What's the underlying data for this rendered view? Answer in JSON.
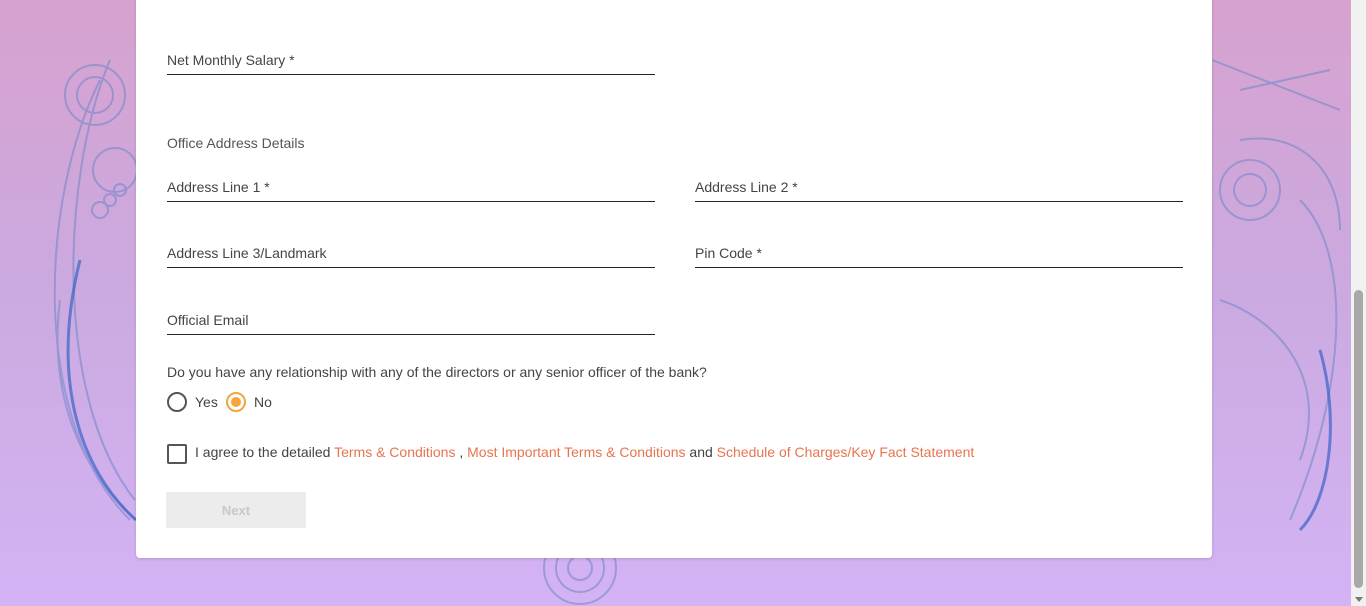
{
  "form": {
    "net_monthly_salary_label": "Net Monthly Salary *",
    "office_section_title": "Office Address Details",
    "address_line1_label": "Address Line 1 *",
    "address_line2_label": "Address Line 2 *",
    "address_line3_label": "Address Line 3/Landmark",
    "pin_code_label": "Pin Code *",
    "official_email_label": "Official Email"
  },
  "relationship": {
    "question": "Do you have any relationship with any of the directors or any senior officer of the bank?",
    "options": [
      {
        "label": "Yes",
        "selected": false
      },
      {
        "label": "No",
        "selected": true
      }
    ]
  },
  "agreement": {
    "prefix": "I agree to the detailed ",
    "link1": "Terms & Conditions",
    "sep1": " , ",
    "link2": "Most Important Terms & Conditions",
    "sep2": " and ",
    "link3": "Schedule of Charges/Key Fact Statement",
    "checked": false
  },
  "next_button_label": "Next",
  "colors": {
    "accent": "#f5a53b",
    "link": "#e8744f",
    "background_top": "#d7a2cf",
    "background_bottom": "#d3b3f4"
  }
}
